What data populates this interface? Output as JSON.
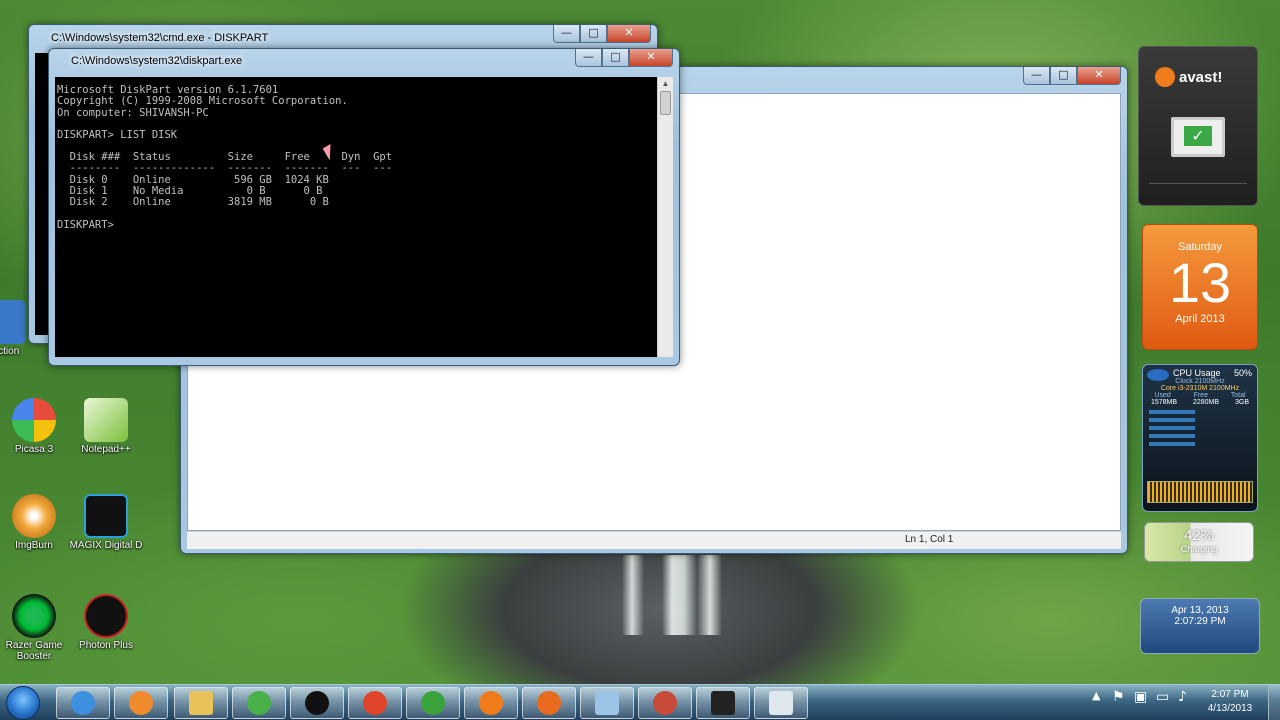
{
  "cmd_window": {
    "title": "C:\\Windows\\system32\\cmd.exe - DISKPART"
  },
  "diskpart_window": {
    "title": "C:\\Windows\\system32\\diskpart.exe",
    "console_lines": [
      "Microsoft DiskPart version 6.1.7601",
      "Copyright (C) 1999-2008 Microsoft Corporation.",
      "On computer: SHIVANSH-PC",
      "",
      "DISKPART> LIST DISK",
      "",
      "  Disk ###  Status         Size     Free     Dyn  Gpt",
      "  --------  -------------  -------  -------  ---  ---",
      "  Disk 0    Online          596 GB  1024 KB",
      "  Disk 1    No Media          0 B      0 B",
      "  Disk 2    Online         3819 MB      0 B",
      "",
      "DISKPART> "
    ]
  },
  "notepad_window": {
    "status_position": "Ln 1, Col 1"
  },
  "window_buttons": {
    "minimize": "—",
    "maximize": "□",
    "close": "✕"
  },
  "desktop_icons": [
    {
      "label": "Picasa 3",
      "icon": "picasa-icon",
      "color": "#e84c3d"
    },
    {
      "label": "Notepad++",
      "icon": "notepadpp-icon",
      "color": "#7bbf3a"
    },
    {
      "label": "ImgBurn",
      "icon": "imgburn-icon",
      "color": "#f2a93b"
    },
    {
      "label": "MAGIX Digital D",
      "icon": "magix-icon",
      "color": "#2aa0d8"
    },
    {
      "label": "Razer Game Booster",
      "icon": "razer-icon",
      "color": "#1db954"
    },
    {
      "label": "Photon Plus",
      "icon": "photon-icon",
      "color": "#cc2222"
    },
    {
      "label": "Diction",
      "icon": "dictionary-icon",
      "color": "#3a78c8"
    }
  ],
  "avast_gadget": {
    "brand": "avast!"
  },
  "calendar_gadget": {
    "day_name": "Saturday",
    "day": "13",
    "month_year": "April 2013"
  },
  "cpu_gadget": {
    "title": "CPU Usage",
    "usage": "50%",
    "clock": "Clock 2100MHz",
    "cpu_model": "Core i3-2310M 2100MHz",
    "columns": [
      "Used",
      "Free",
      "Total"
    ],
    "ram": [
      "1578MB",
      "2280MB",
      "3GB"
    ]
  },
  "battery_gadget": {
    "percent": "42%",
    "status": "Charging"
  },
  "clock_gadget": {
    "date": "Apr 13, 2013",
    "time": "2:07:29 PM"
  },
  "taskbar": {
    "items": [
      {
        "icon": "ie-icon",
        "color": "#3d8fe0"
      },
      {
        "icon": "media-player-icon",
        "color": "#f08a2c"
      },
      {
        "icon": "explorer-icon",
        "color": "#e8c35a"
      },
      {
        "icon": "globe-icon",
        "color": "#4ab04a"
      },
      {
        "icon": "photon-icon",
        "color": "#111111"
      },
      {
        "icon": "chrome-icon",
        "color": "#e0452b"
      },
      {
        "icon": "utorrent-icon",
        "color": "#3ba33b"
      },
      {
        "icon": "avast-icon",
        "color": "#f07b1a"
      },
      {
        "icon": "firefox-icon",
        "color": "#e86a1f"
      },
      {
        "icon": "window-icon",
        "color": "#9bc4e6"
      },
      {
        "icon": "paint-icon",
        "color": "#c84a3a"
      },
      {
        "icon": "cmd-icon",
        "color": "#222222"
      },
      {
        "icon": "notepad-icon",
        "color": "#dfe8ef"
      }
    ],
    "tray_time": "2:07 PM",
    "tray_date": "4/13/2013"
  }
}
